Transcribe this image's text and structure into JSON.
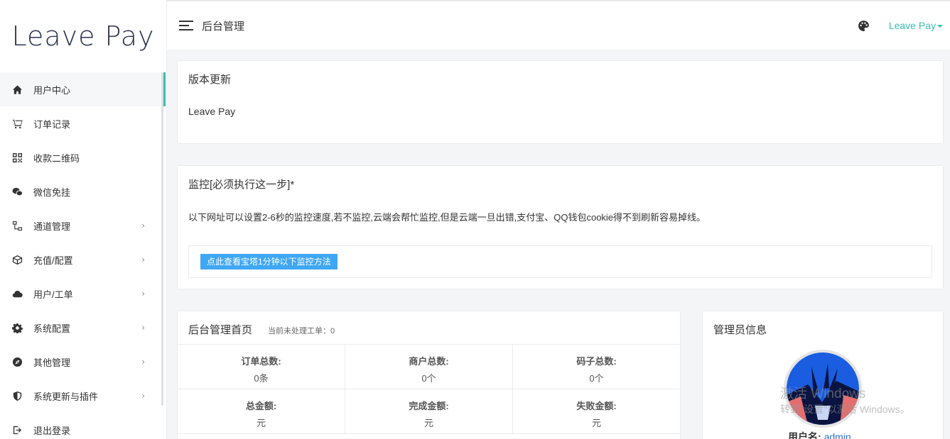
{
  "brand": "Leave Pay",
  "sidebar": {
    "items": [
      {
        "label": "用户中心",
        "icon": "home-icon",
        "arrow": ""
      },
      {
        "label": "订单记录",
        "icon": "cart-icon",
        "arrow": ""
      },
      {
        "label": "收款二维码",
        "icon": "qrcode-icon",
        "arrow": ""
      },
      {
        "label": "微信免挂",
        "icon": "wechat-icon",
        "arrow": ""
      },
      {
        "label": "通道管理",
        "icon": "channel-icon",
        "arrow": "›"
      },
      {
        "label": "充值/配置",
        "icon": "box-icon",
        "arrow": "›"
      },
      {
        "label": "用户/工单",
        "icon": "cloud-icon",
        "arrow": "›"
      },
      {
        "label": "系统配置",
        "icon": "gear-icon",
        "arrow": "›"
      },
      {
        "label": "其他管理",
        "icon": "compass-icon",
        "arrow": "›"
      },
      {
        "label": "系统更新与插件",
        "icon": "shield-icon",
        "arrow": "›"
      },
      {
        "label": "退出登录",
        "icon": "logout-icon",
        "arrow": ""
      }
    ]
  },
  "header": {
    "title": "后台管理",
    "user": "Leave Pay",
    "palette_icon": "palette-icon",
    "menu_icon": "menu-icon"
  },
  "version_card": {
    "title": "版本更新",
    "body": "Leave Pay"
  },
  "monitor_card": {
    "title": "监控[必须执行这一步]*",
    "body": "以下网址可以设置2-6秒的监控速度,若不监控,云端会帮忙监控,但是云端一旦出错,支付宝、QQ钱包cookie得不到刷新容易掉线。",
    "button": "点此查看宝塔1分钟以下监控方法"
  },
  "home_card": {
    "title": "后台管理首页",
    "sub_label": "当前未处理工单：",
    "sub_value": "0",
    "stats": [
      {
        "label": "订单总数:",
        "value": "0条"
      },
      {
        "label": "商户总数:",
        "value": "0个"
      },
      {
        "label": "码子总数:",
        "value": "0个"
      },
      {
        "label": "总金额:",
        "value": "元"
      },
      {
        "label": "完成金额:",
        "value": "元"
      },
      {
        "label": "失败金额:",
        "value": "元"
      }
    ]
  },
  "admin_card": {
    "title": "管理员信息",
    "username_label": "用户名:",
    "username": "admin"
  },
  "watermark": {
    "line1": "激活 Windows",
    "line2": "转到\"设置\"以激活 Windows。"
  },
  "colors": {
    "accent": "#3cbcb1",
    "button": "#3fa7f4",
    "link": "#2a72c9"
  }
}
